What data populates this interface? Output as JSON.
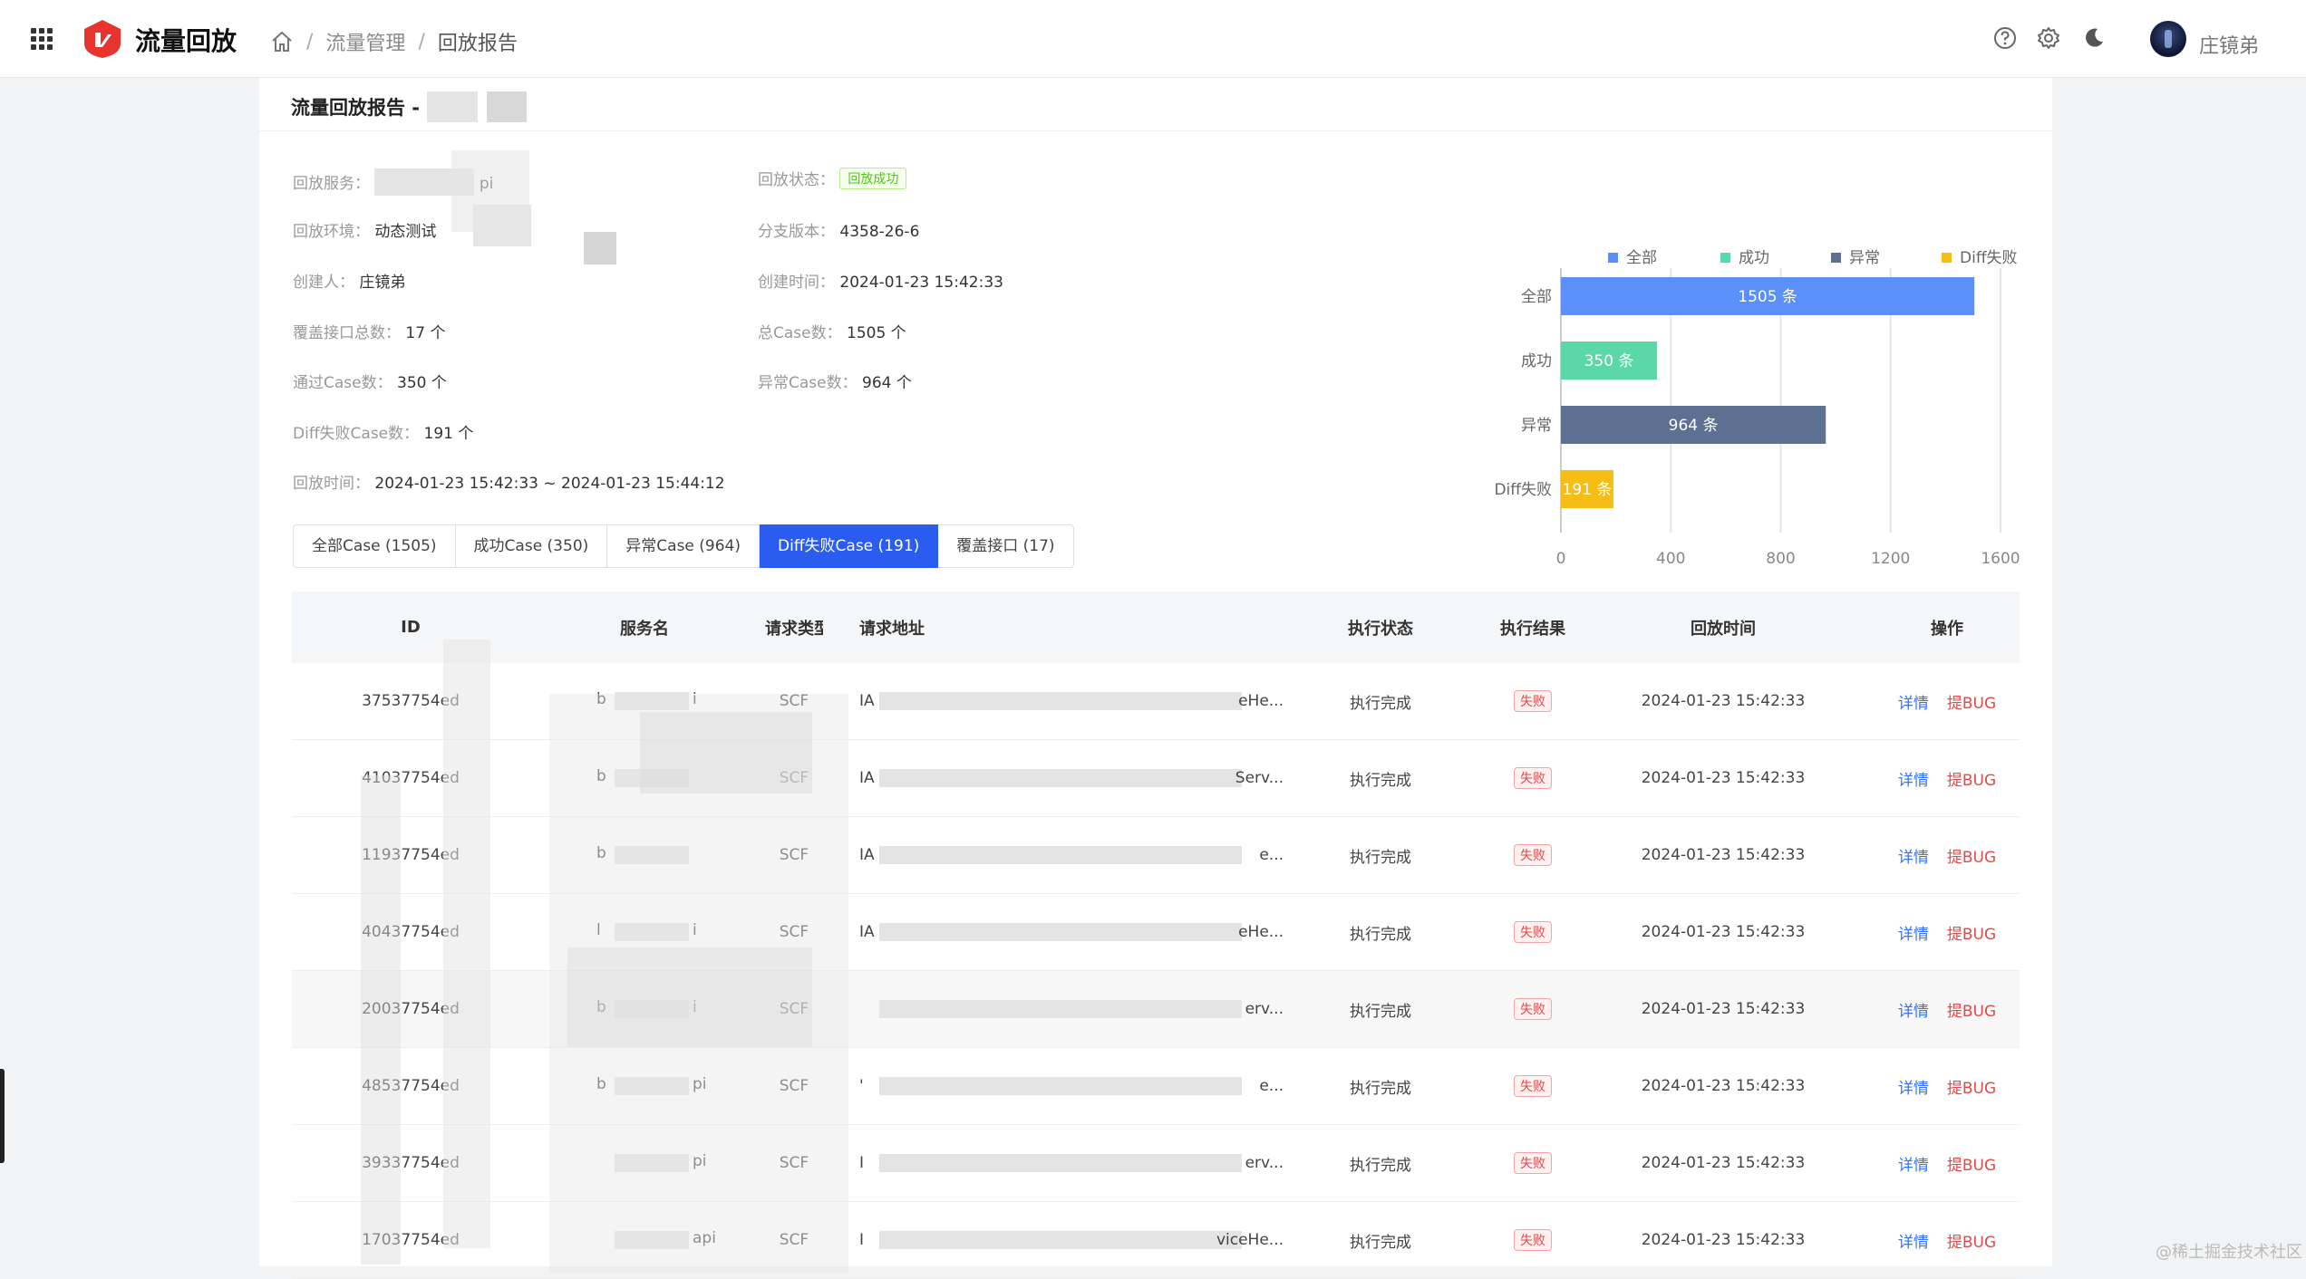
{
  "app": {
    "title": "流量回放",
    "brand_color": "#e8342e"
  },
  "breadcrumb": {
    "home_icon": "home-icon",
    "items": [
      "流量管理",
      "回放报告"
    ]
  },
  "topbar": {
    "icons": [
      "help-icon",
      "gear-icon",
      "moon-icon"
    ],
    "user_name": "庄镜弟"
  },
  "report": {
    "title_prefix": "流量回放报告 -",
    "info": {
      "service_label": "回放服务：",
      "service_value": "pi",
      "status_label": "回放状态：",
      "status_value": "回放成功",
      "env_label": "回放环境：",
      "env_value": "动态测试",
      "branch_label": "分支版本：",
      "branch_value": "4358-26-6",
      "creator_label": "创建人：",
      "creator_value": "庄镜弟",
      "created_label": "创建时间：",
      "created_value": "2024-01-23 15:42:33",
      "api_count_label": "覆盖接口总数：",
      "api_count_value": "17 个",
      "total_case_label": "总Case数：",
      "total_case_value": "1505 个",
      "pass_case_label": "通过Case数：",
      "pass_case_value": "350 个",
      "error_case_label": "异常Case数：",
      "error_case_value": "964 个",
      "diff_case_label": "Diff失败Case数：",
      "diff_case_value": "191 个",
      "replay_time_label": "回放时间：",
      "replay_time_value": "2024-01-23 15:42:33 ~ 2024-01-23 15:44:12"
    }
  },
  "chart_data": {
    "type": "bar",
    "orientation": "horizontal",
    "categories": [
      "全部",
      "成功",
      "异常",
      "Diff失败"
    ],
    "values": [
      1505,
      350,
      964,
      191
    ],
    "data_labels": [
      "1505 条",
      "350 条",
      "964 条",
      "191 条"
    ],
    "colors": [
      "#5b8ff9",
      "#5ad8a6",
      "#5d7092",
      "#f6bd16"
    ],
    "legend": [
      "全部",
      "成功",
      "异常",
      "Diff失败"
    ],
    "legend_position": "top",
    "xlim": [
      0,
      1600
    ],
    "xticks": [
      "0",
      "400",
      "800",
      "1200",
      "1600"
    ],
    "grid": true
  },
  "tabs": [
    {
      "label": "全部Case (1505)",
      "active": false
    },
    {
      "label": "成功Case (350)",
      "active": false
    },
    {
      "label": "异常Case (964)",
      "active": false
    },
    {
      "label": "Diff失败Case (191)",
      "active": true
    },
    {
      "label": "覆盖接口 (17)",
      "active": false
    }
  ],
  "table": {
    "headers": [
      "ID",
      "服务名",
      "请求类型",
      "请求地址",
      "执行状态",
      "执行结果",
      "回放时间",
      "操作"
    ],
    "rows": [
      {
        "id": "37537754ed",
        "service": "b",
        "service_tail": "i",
        "type": "SCF",
        "addr": "IA",
        "addr_tail": "eHe...",
        "status": "执行完成",
        "result": "失败",
        "time": "2024-01-23 15:42:33"
      },
      {
        "id": "41037754ed",
        "service": "b",
        "service_tail": "",
        "type": "SCF",
        "addr": "IA",
        "addr_tail": "Serv...",
        "status": "执行完成",
        "result": "失败",
        "time": "2024-01-23 15:42:33"
      },
      {
        "id": "11937754ed",
        "service": "b",
        "service_tail": "",
        "type": "SCF",
        "addr": "IA",
        "addr_tail": "e...",
        "status": "执行完成",
        "result": "失败",
        "time": "2024-01-23 15:42:33"
      },
      {
        "id": "40437754ed",
        "service": "l",
        "service_tail": "i",
        "type": "SCF",
        "addr": "IA",
        "addr_tail": "eHe...",
        "status": "执行完成",
        "result": "失败",
        "time": "2024-01-23 15:42:33"
      },
      {
        "id": "20037754ed",
        "service": "b",
        "service_tail": "i",
        "type": "SCF",
        "addr": "",
        "addr_tail": "erv...",
        "status": "执行完成",
        "result": "失败",
        "time": "2024-01-23 15:42:33"
      },
      {
        "id": "48537754ed",
        "service": "b",
        "service_tail": "pi",
        "type": "SCF",
        "addr": "'",
        "addr_tail": "e...",
        "status": "执行完成",
        "result": "失败",
        "time": "2024-01-23 15:42:33"
      },
      {
        "id": "39337754ed",
        "service": "",
        "service_tail": "pi",
        "type": "SCF",
        "addr": "I",
        "addr_tail": "erv...",
        "status": "执行完成",
        "result": "失败",
        "time": "2024-01-23 15:42:33"
      },
      {
        "id": "17037754ed",
        "service": "",
        "service_tail": "api",
        "type": "SCF",
        "addr": "I",
        "addr_tail": "viceHe...",
        "status": "执行完成",
        "result": "失败",
        "time": "2024-01-23 15:42:33"
      }
    ],
    "actions": {
      "detail": "详情",
      "bug": "提BUG"
    }
  },
  "watermark": "@稀土掘金技术社区"
}
